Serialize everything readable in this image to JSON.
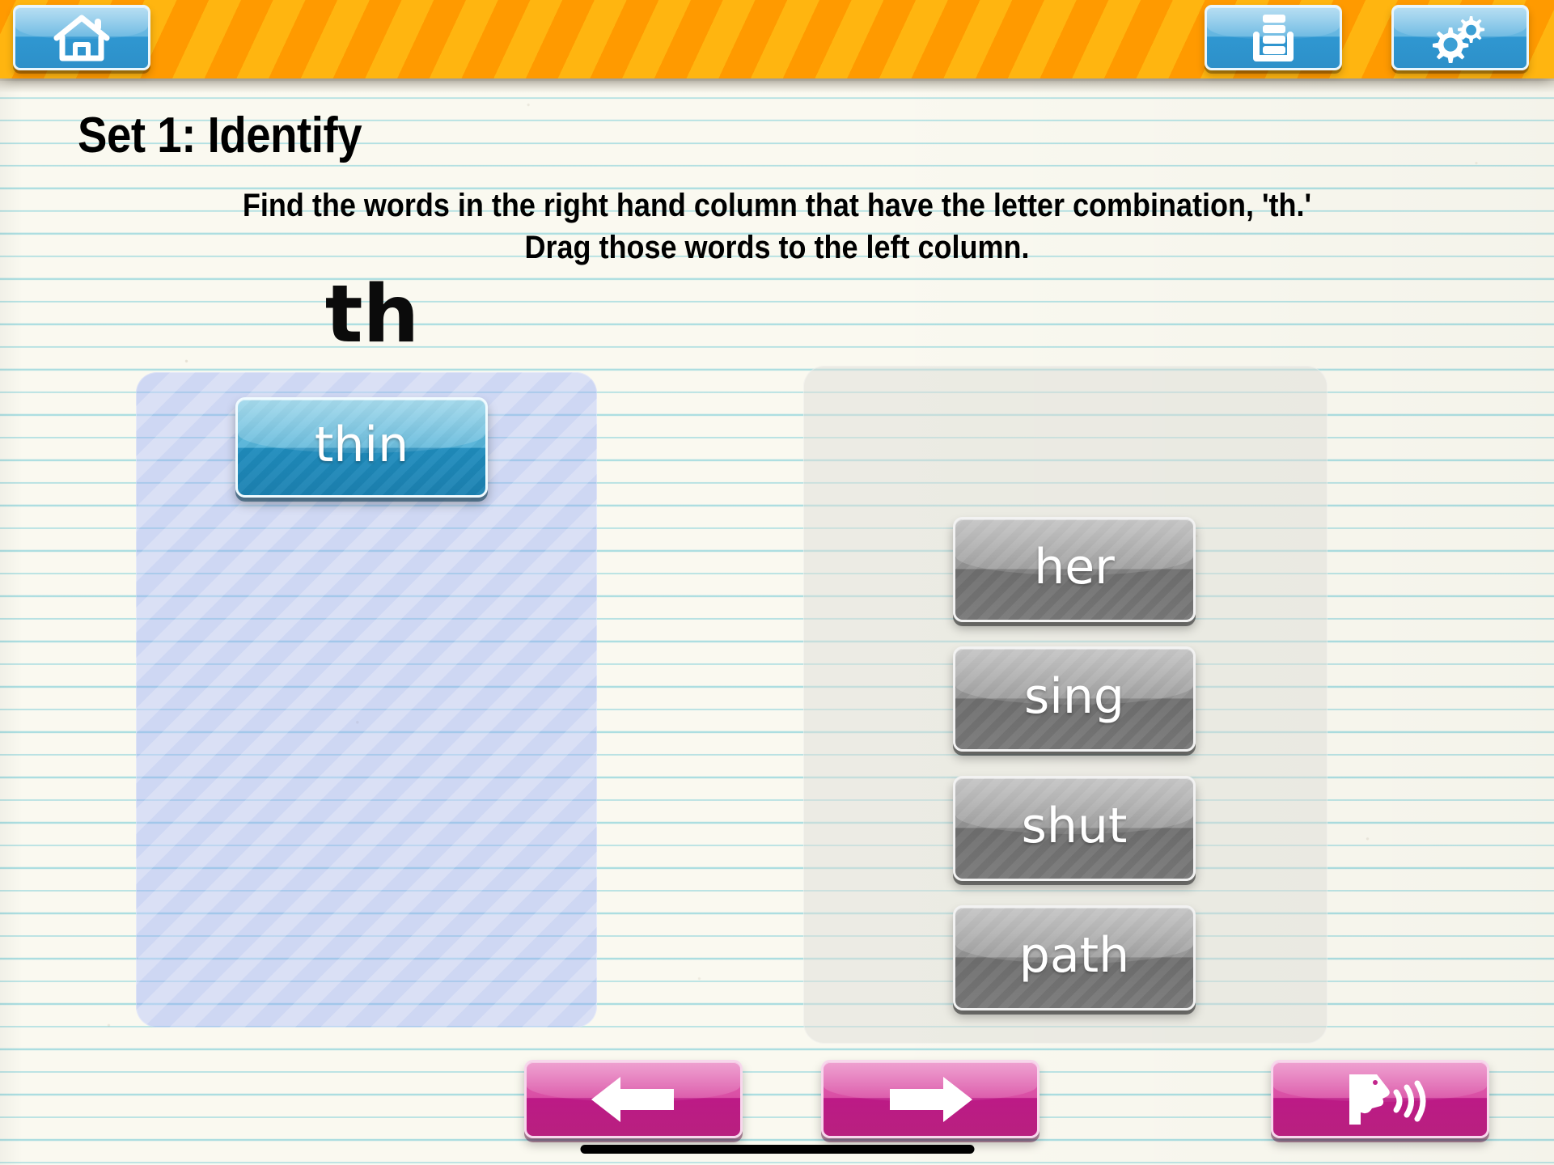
{
  "header": {
    "buttons": [
      {
        "name": "home-button",
        "icon": "home-icon",
        "label": "Home"
      },
      {
        "name": "wordlist-button",
        "icon": "word-list-icon",
        "label": "Word List"
      },
      {
        "name": "settings-button",
        "icon": "gears-icon",
        "label": "Settings"
      }
    ]
  },
  "lesson": {
    "title": "Set 1: Identify",
    "instruction_line1": "Find the words in the right hand column that have the letter combination, 'th.'",
    "instruction_line2": "Drag those words to the left column.",
    "pattern": "th"
  },
  "drop_zone": {
    "name": "answer-drop-zone",
    "placed_words": [
      {
        "label": "thin"
      }
    ]
  },
  "source_zone": {
    "name": "word-bank",
    "words": [
      {
        "label": "her"
      },
      {
        "label": "sing"
      },
      {
        "label": "shut"
      },
      {
        "label": "path"
      }
    ]
  },
  "footer": {
    "buttons": [
      {
        "name": "previous-button",
        "icon": "arrow-left-icon",
        "label": "Previous"
      },
      {
        "name": "next-button",
        "icon": "arrow-right-icon",
        "label": "Next"
      },
      {
        "name": "speak-button",
        "icon": "speaking-head-icon",
        "label": "Speak"
      }
    ]
  },
  "colors": {
    "header_orange_light": "#ffb510",
    "header_orange_dark": "#ff9a00",
    "button_blue": "#2f97d1",
    "tile_blue": "#1f8cbd",
    "tile_grey": "#6f6f6f",
    "nav_pink": "#bc1a86",
    "paper": "#faf9f0",
    "rule_line": "#6cc8d4"
  }
}
